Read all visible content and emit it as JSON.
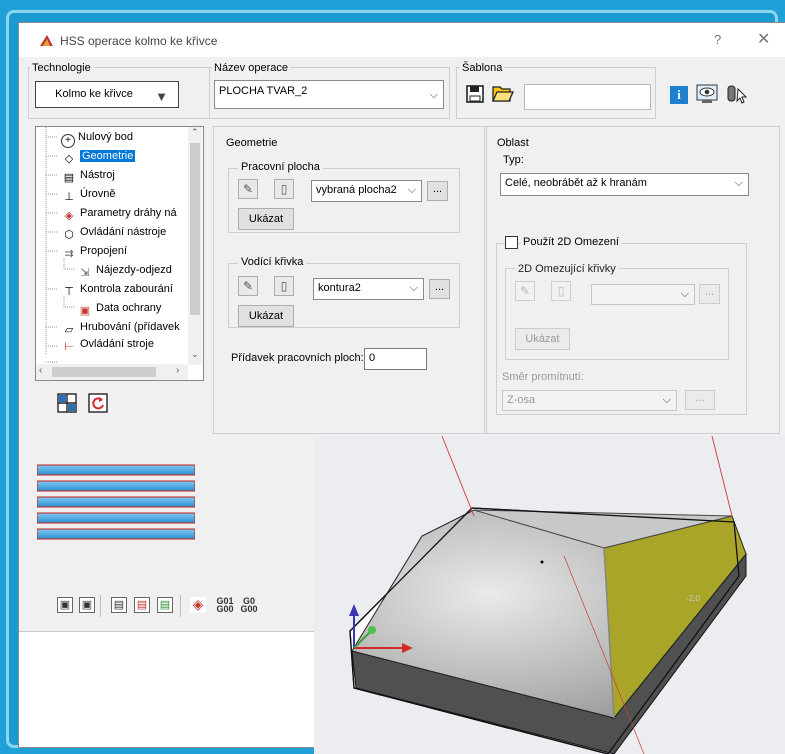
{
  "window": {
    "title": "HSS operace kolmo ke křivce",
    "help": "?",
    "close": "✕"
  },
  "technology": {
    "label": "Technologie",
    "value": "Kolmo ke křivce"
  },
  "operation_name": {
    "label": "Název operace",
    "value": "PLOCHA TVAR_2"
  },
  "template": {
    "label": "Šablona",
    "value": ""
  },
  "tree": {
    "items": [
      {
        "label": "Nulový bod",
        "icon": "crosshair-icon"
      },
      {
        "label": "Geometrie",
        "icon": "geometry-icon"
      },
      {
        "label": "Nástroj",
        "icon": "tool-icon"
      },
      {
        "label": "Úrovně",
        "icon": "levels-icon"
      },
      {
        "label": "Parametry dráhy ná",
        "icon": "cube-icon"
      },
      {
        "label": "Ovládání nástroje",
        "icon": "tool-control-icon"
      },
      {
        "label": "Propojení",
        "icon": "links-icon"
      },
      {
        "label": "Nájezdy-odjezd",
        "icon": "approach-icon"
      },
      {
        "label": "Kontrola zabourání",
        "icon": "collision-icon"
      },
      {
        "label": "Data ochrany",
        "icon": "protection-icon"
      },
      {
        "label": "Hrubování (přídavek",
        "icon": "roughing-icon"
      },
      {
        "label": "Ovládání stroje",
        "icon": "machine-icon"
      }
    ]
  },
  "geometry": {
    "label": "Geometrie",
    "work_surface": {
      "label": "Pracovní plocha",
      "value": "vybraná plocha2",
      "show": "Ukázat",
      "dots": "..."
    },
    "guide_curve": {
      "label": "Vodící křivka",
      "value": "kontura2",
      "show": "Ukázat",
      "dots": "..."
    },
    "allowance": {
      "label": "Přídavek pracovních ploch:",
      "value": "0"
    }
  },
  "area": {
    "label": "Oblast",
    "type_label": "Typ:",
    "type_value": "Celé, neobrábět až k hranám",
    "use_2d_limit": {
      "label": "Použít 2D Omezení",
      "checked": false
    },
    "limit_curves": {
      "label": "2D Omezující křivky",
      "value": "",
      "show": "Ukázat",
      "dots": "..."
    },
    "projection": {
      "label": "Směr promítnutí:",
      "value": "Z-osa",
      "dots": "..."
    }
  },
  "toolbar": {
    "code1": "G01 G00",
    "code2": "G0 G00"
  },
  "viewport": {
    "dim_label": "-2,0"
  },
  "colors": {
    "accent": "#0078d7",
    "background": "#1fa0d6",
    "surface": "#f0f0f0",
    "wave": "#45a9dc",
    "wave_line": "#c61a1a",
    "mesh": "#8a8a8a",
    "face": "#a9a528",
    "solid": "#505050"
  }
}
